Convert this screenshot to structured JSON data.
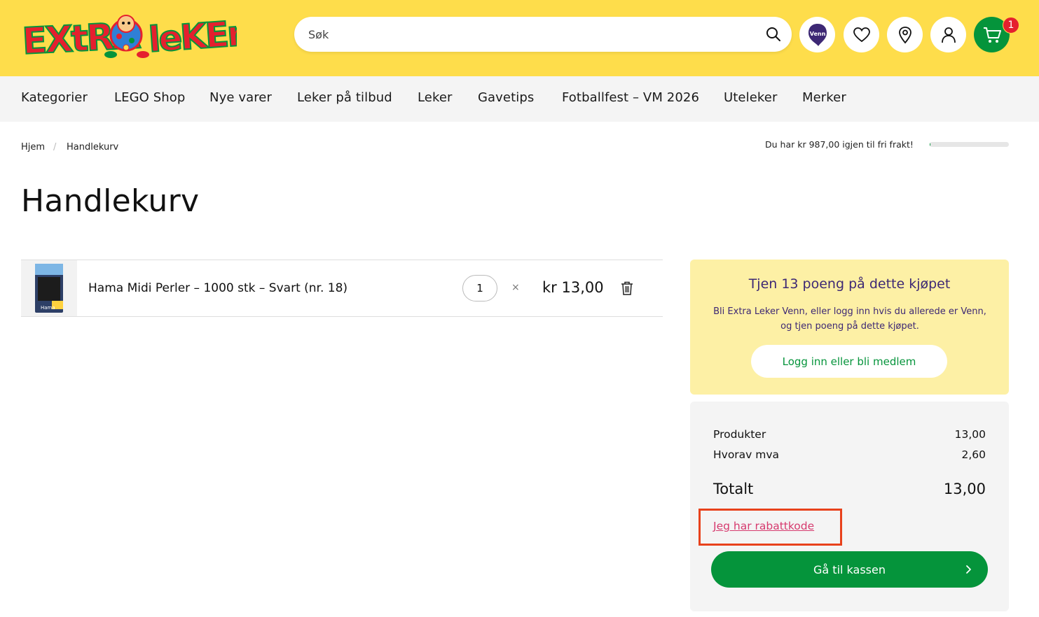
{
  "header": {
    "logo_text": "ExtraLeker",
    "search_placeholder": "Søk",
    "venn_label": "Venn",
    "cart_count": "1"
  },
  "nav": {
    "items": [
      "Kategorier",
      "LEGO Shop",
      "Nye varer",
      "Leker på tilbud",
      "Leker",
      "Gavetips",
      "Fotballfest – VM 2026",
      "Uteleker",
      "Merker"
    ]
  },
  "breadcrumb": {
    "home": "Hjem",
    "separator": "/",
    "current": "Handlekurv"
  },
  "freight": {
    "text": "Du har kr 987,00 igjen til fri frakt!",
    "progress": 0.013
  },
  "page": {
    "title": "Handlekurv"
  },
  "cart": {
    "items": [
      {
        "name": "Hama Midi Perler – 1000 stk – Svart (nr. 18)",
        "quantity": "1",
        "times": "×",
        "price": "kr 13,00",
        "thumb_label": "Hama"
      }
    ]
  },
  "loyalty": {
    "title": "Tjen 13 poeng på dette kjøpet",
    "text": "Bli Extra Leker Venn, eller logg inn hvis du allerede er Venn, og tjen poeng på dette kjøpet.",
    "button": "Logg inn eller bli medlem"
  },
  "summary": {
    "products_label": "Produkter",
    "products_value": "13,00",
    "vat_label": "Hvorav mva",
    "vat_value": "2,60",
    "total_label": "Totalt",
    "total_value": "13,00",
    "discount_link": "Jeg har rabattkode",
    "checkout_button": "Gå til kassen"
  },
  "colors": {
    "header_yellow": "#fedd4b",
    "brand_green": "#05943b",
    "loyalty_purple": "#3d2874",
    "badge_red": "#e5202e",
    "highlight_orange": "#e8421c"
  }
}
